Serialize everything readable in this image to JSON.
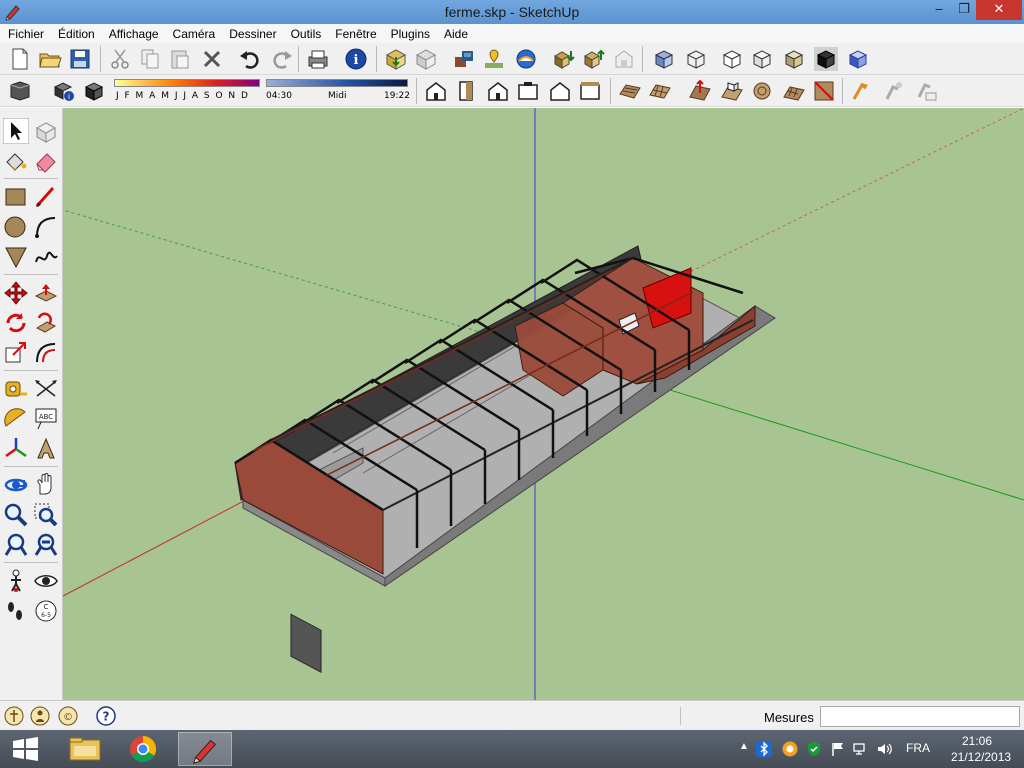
{
  "window": {
    "title": "ferme.skp - SketchUp",
    "controls": {
      "minimize": "‒",
      "maximize": "❐",
      "close": "✕"
    }
  },
  "menu": {
    "items": [
      "Fichier",
      "Édition",
      "Affichage",
      "Caméra",
      "Dessiner",
      "Outils",
      "Fenêtre",
      "Plugins",
      "Aide"
    ]
  },
  "toolbar1": {
    "icons": [
      "new-file-icon",
      "open-file-icon",
      "save-icon",
      "cut-icon",
      "copy-icon",
      "paste-icon",
      "delete-icon",
      "undo-icon",
      "redo-icon",
      "print-icon",
      "model-info-icon",
      "get-models-icon",
      "share-model-icon",
      "photo-texture-icon",
      "add-location-icon",
      "toggle-terrain-icon",
      "get-components-icon",
      "share-component-icon",
      "extension-warehouse-icon",
      "xray-style-icon",
      "wireframe-style-icon",
      "hidden-line-style-icon",
      "shaded-style-icon",
      "shaded-textures-style-icon",
      "monochrome-style-icon",
      "back-edges-style-icon"
    ]
  },
  "toolbar2": {
    "icons": [
      "fog-icon",
      "shadow-settings-icon",
      "display-shadows-icon",
      "iso-view-icon",
      "top-view-icon",
      "front-view-icon",
      "right-view-icon",
      "back-view-icon",
      "left-view-icon",
      "sandbox-from-contours-icon",
      "sandbox-from-scratch-icon",
      "smoove-icon",
      "stamp-icon",
      "drape-icon",
      "add-detail-icon",
      "flip-edge-icon",
      "dynamic-component-interact-icon",
      "dynamic-component-options-icon",
      "dynamic-component-attributes-icon"
    ],
    "shadow": {
      "months": "J F M A M J J A S O N D",
      "time_start": "04:30",
      "time_mid": "Midi",
      "time_end": "19:22"
    }
  },
  "tools": {
    "icons": [
      "select-icon",
      "make-component-icon",
      "paint-bucket-icon",
      "eraser-icon",
      "rectangle-icon",
      "line-icon",
      "circle-icon",
      "arc-icon",
      "polygon-icon",
      "freehand-icon",
      "move-icon",
      "push-pull-icon",
      "rotate-icon",
      "follow-me-icon",
      "scale-icon",
      "offset-icon",
      "tape-measure-icon",
      "dimensions-icon",
      "protractor-icon",
      "text-icon",
      "axes-icon",
      "3d-text-icon",
      "orbit-icon",
      "pan-icon",
      "zoom-icon",
      "zoom-window-icon",
      "previous-view-icon",
      "zoom-extents-icon",
      "position-camera-icon",
      "look-around-icon",
      "walk-icon",
      "section-plane-icon"
    ]
  },
  "statusbar": {
    "icons": [
      "geo-location-icon",
      "credits-icon",
      "user-login-icon",
      "help-icon"
    ],
    "measure_label": "Mesures",
    "measure_value": ""
  },
  "taskbar": {
    "apps": [
      "start-button",
      "file-explorer-icon",
      "chrome-icon",
      "sketchup-icon"
    ],
    "tray": [
      "show-hidden-icons",
      "bluetooth-icon",
      "app-tray-icon",
      "security-shield-icon",
      "action-center-flag-icon",
      "network-icon",
      "volume-icon"
    ],
    "language": "FRA",
    "time": "21:06",
    "date": "21/12/2013"
  },
  "colors": {
    "title_bar": "#5a93d0",
    "viewport": "#a9c493",
    "brick": "#9a4a3a",
    "close_button": "#c7372f"
  }
}
